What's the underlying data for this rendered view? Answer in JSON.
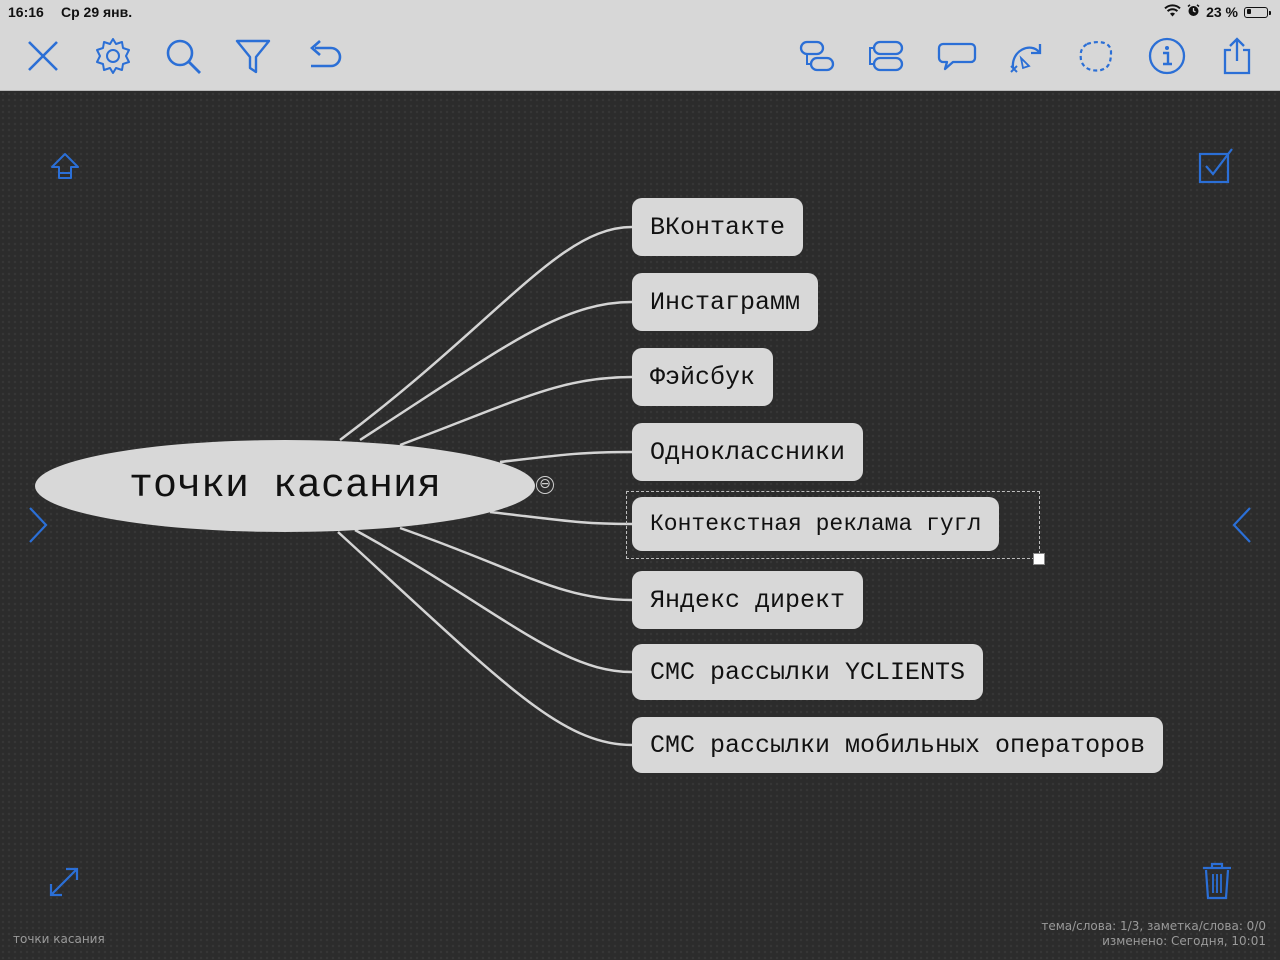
{
  "status_bar": {
    "time": "16:16",
    "date": "Ср 29 янв.",
    "battery_text": "23 %",
    "battery_level": 0.23
  },
  "toolbar": {
    "left_icons": [
      "close-icon",
      "gear-icon",
      "search-icon",
      "filter-icon",
      "undo-icon"
    ],
    "right_icons": [
      "add-child-topic-icon",
      "add-sibling-topic-icon",
      "callout-icon",
      "relation-icon",
      "boundary-icon",
      "info-icon",
      "share-icon"
    ],
    "accent_color": "#2b6fd6"
  },
  "mindmap": {
    "root": {
      "label": "точки касания"
    },
    "children": [
      {
        "label": "ВКонтакте"
      },
      {
        "label": "Инстаграмм"
      },
      {
        "label": "Фэйсбук"
      },
      {
        "label": "Одноклассники"
      },
      {
        "label": "Контекстная реклама гугл",
        "selected": true
      },
      {
        "label": "Яндекс директ"
      },
      {
        "label": "СМС рассылки YCLIENTS"
      },
      {
        "label": "СМС рассылки мобильных операторов"
      }
    ],
    "collapse_glyph": "⊖"
  },
  "canvas_controls": {
    "up_icon": "arrow-up-icon",
    "checklist_icon": "checkbox-icon",
    "prev_icon": "chevron-right-icon",
    "next_icon": "chevron-left-icon",
    "expand_icon": "expand-icon",
    "trash_icon": "trash-icon"
  },
  "footer": {
    "document_title": "точки касания",
    "stats": "тема/слова: 1/3, заметка/слова: 0/0",
    "modified": "изменено: Сегодня, 10:01"
  }
}
